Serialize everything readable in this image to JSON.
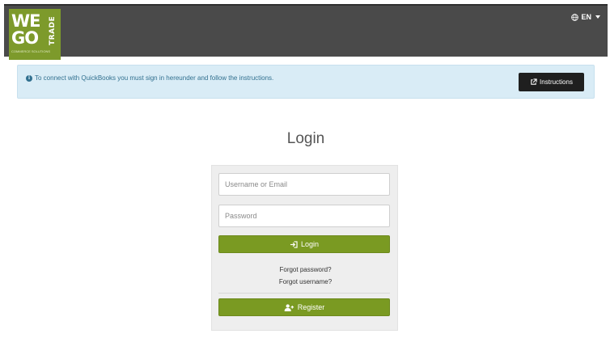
{
  "header": {
    "logo": {
      "line1": "WE",
      "line2": "GO",
      "line3": "TRADE",
      "tagline": "COMMERCE SOLUTIONS"
    },
    "language": {
      "label": "EN",
      "icon": "globe-icon"
    },
    "background_color": "#4a4a4a"
  },
  "banner": {
    "message": "To connect with QuickBooks you must sign in hereunder and follow the instructions.",
    "icon": "info-icon",
    "instructions_button": {
      "label": "Instructions",
      "icon": "external-link-icon"
    }
  },
  "login": {
    "title": "Login",
    "username_placeholder": "Username or Email",
    "password_placeholder": "Password",
    "login_button": {
      "label": "Login",
      "icon": "sign-in-icon"
    },
    "forgot_password": "Forgot password?",
    "forgot_username": "Forgot username?",
    "register_button": {
      "label": "Register",
      "icon": "user-plus-icon"
    }
  },
  "colors": {
    "brand_green": "#7a9a22",
    "banner_bg": "#d9ecf6",
    "banner_text": "#31708f"
  }
}
